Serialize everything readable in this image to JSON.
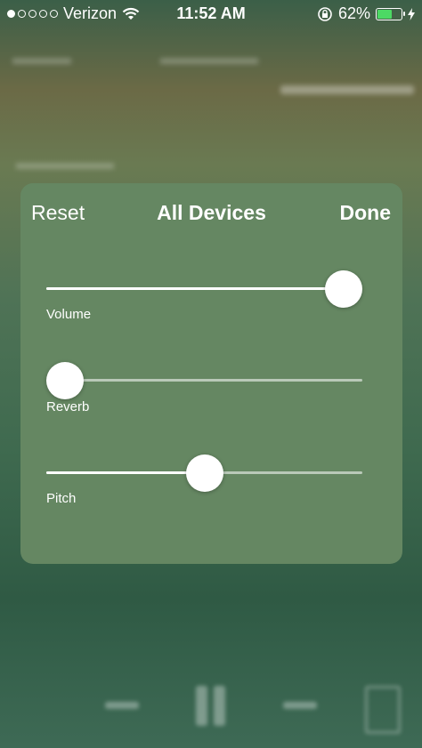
{
  "status_bar": {
    "carrier": "Verizon",
    "time": "11:52 AM",
    "battery_percent_text": "62%",
    "battery_level": 0.62
  },
  "panel": {
    "reset_label": "Reset",
    "title": "All Devices",
    "done_label": "Done",
    "sliders": [
      {
        "label": "Volume",
        "value": 0.94
      },
      {
        "label": "Reverb",
        "value": 0.0
      },
      {
        "label": "Pitch",
        "value": 0.5
      }
    ]
  },
  "colors": {
    "panel_bg": "#658762",
    "battery_fill": "#4cd964"
  }
}
